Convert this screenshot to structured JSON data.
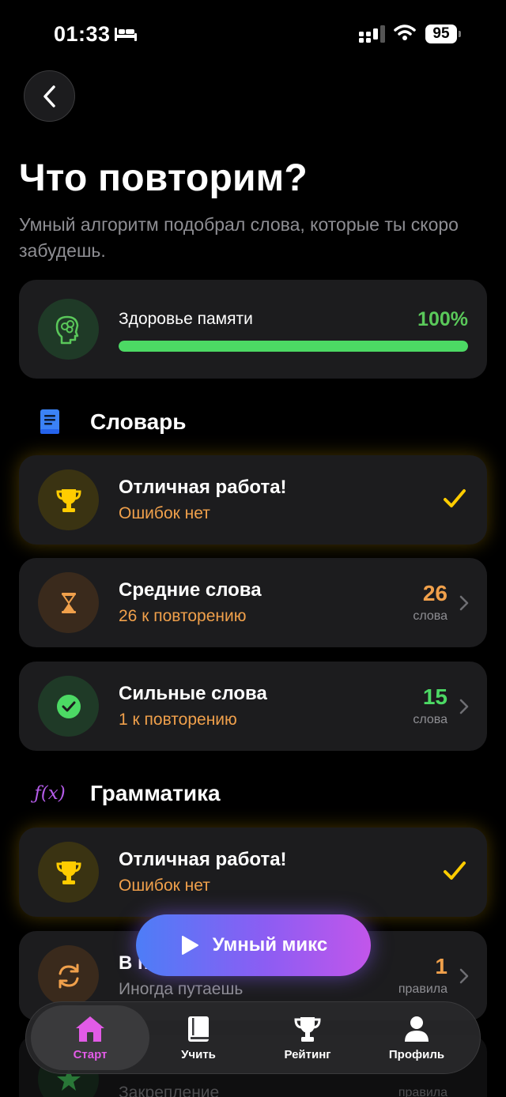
{
  "status_bar": {
    "time": "01:33",
    "battery": "95"
  },
  "header": {
    "title": "Что повторим?",
    "subtitle": "Умный алгоритм подобрал слова, которые ты скоро забудешь."
  },
  "memory": {
    "label": "Здоровье памяти",
    "percent_text": "100%",
    "value_percent": 100
  },
  "vocabulary": {
    "title": "Словарь",
    "cards": [
      {
        "title": "Отличная работа!",
        "subtitle": "Ошибок нет"
      },
      {
        "title": "Средние слова",
        "subtitle": "26 к повторению",
        "count": "26",
        "count_label": "слова"
      },
      {
        "title": "Сильные слова",
        "subtitle": "1 к повторению",
        "count": "15",
        "count_label": "слова"
      }
    ]
  },
  "grammar": {
    "title": "Грамматика",
    "icon_text": "ƒ(x)",
    "cards": [
      {
        "title": "Отличная работа!",
        "subtitle": "Ошибок нет"
      },
      {
        "title": "В п",
        "subtitle": "Иногда путаешь",
        "count": "1",
        "count_label": "правила"
      },
      {
        "title": "",
        "subtitle": "Закрепление",
        "count": "",
        "count_label": "правила"
      }
    ]
  },
  "fab": {
    "label": "Умный микс"
  },
  "tabs": [
    {
      "label": "Старт"
    },
    {
      "label": "Учить"
    },
    {
      "label": "Рейтинг"
    },
    {
      "label": "Профиль"
    }
  ],
  "colors": {
    "accent_green": "#4cd964",
    "accent_orange": "#f0a04b",
    "accent_yellow": "#ffcc00",
    "accent_pink": "#e25be6",
    "fab_gradient_start": "#4d7df7",
    "fab_gradient_end": "#c256ea"
  }
}
